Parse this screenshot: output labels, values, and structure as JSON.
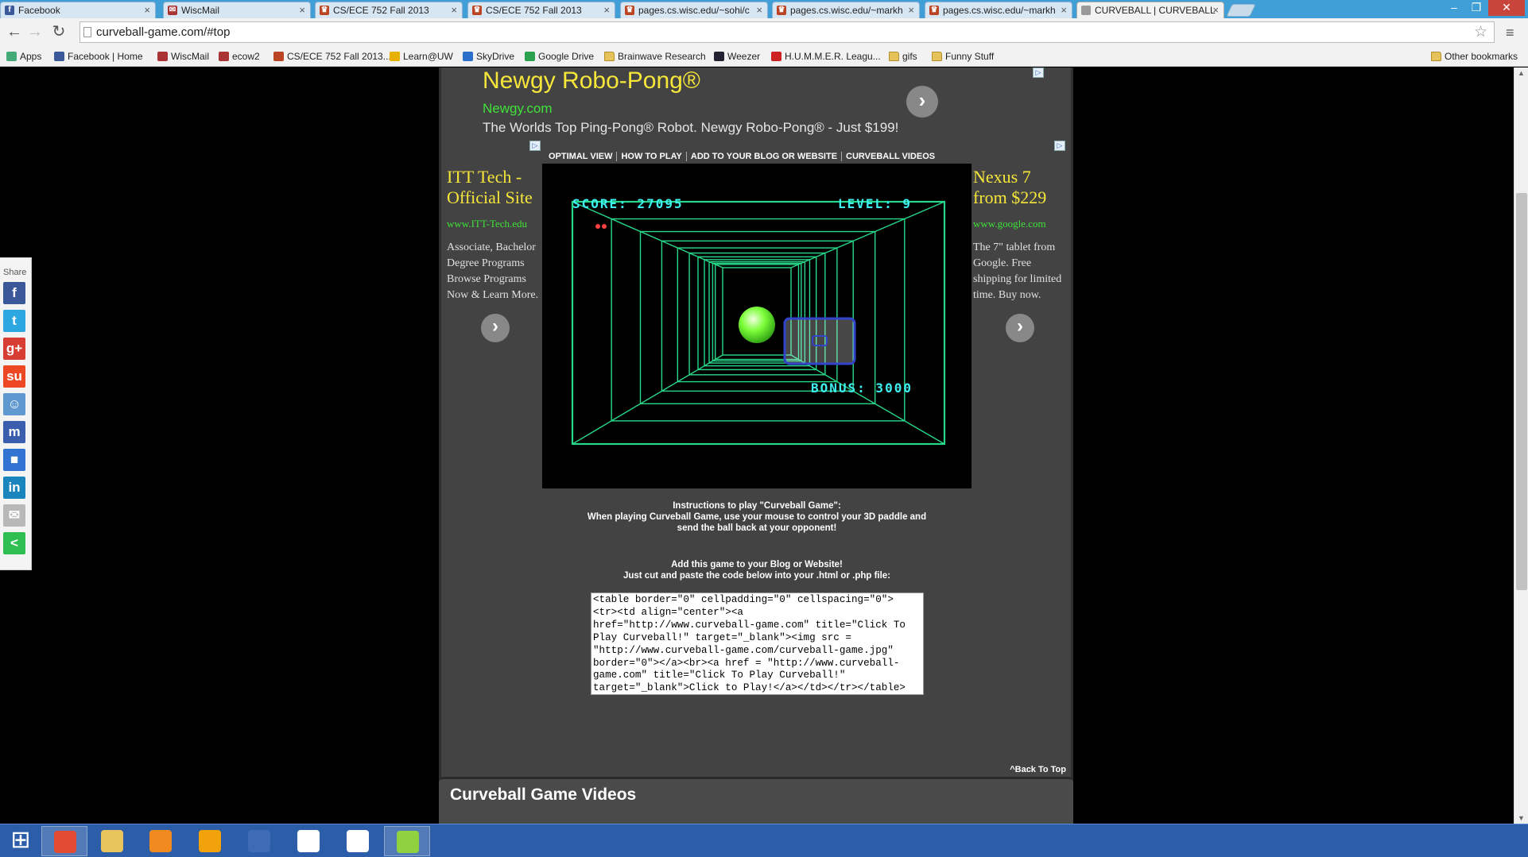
{
  "browser": {
    "tabs": [
      {
        "title": "Facebook",
        "icon": "facebook-icon",
        "color": "#3b5998",
        "glyph": "f"
      },
      {
        "title": "WiscMail",
        "icon": "mail-icon",
        "color": "#a33",
        "glyph": "✉"
      },
      {
        "title": "CS/ECE 752 Fall 2013",
        "icon": "uw-crest-icon",
        "color": "#b42",
        "glyph": "♛"
      },
      {
        "title": "CS/ECE 752 Fall 2013",
        "icon": "uw-crest-icon",
        "color": "#b42",
        "glyph": "♛"
      },
      {
        "title": "pages.cs.wisc.edu/~sohi/c",
        "icon": "uw-crest-icon",
        "color": "#b42",
        "glyph": "♛"
      },
      {
        "title": "pages.cs.wisc.edu/~markh",
        "icon": "uw-crest-icon",
        "color": "#b42",
        "glyph": "♛"
      },
      {
        "title": "pages.cs.wisc.edu/~markh",
        "icon": "uw-crest-icon",
        "color": "#b42",
        "glyph": "♛"
      },
      {
        "title": "CURVEBALL | CURVEBALL",
        "icon": "page-icon",
        "color": "#999",
        "glyph": ""
      }
    ],
    "tab_close_glyph": "×",
    "window_controls": {
      "minimize": "–",
      "maximize": "❐",
      "close": "✕"
    },
    "nav": {
      "back": "←",
      "forward": "→",
      "reload": "↻"
    },
    "url": "curveball-game.com/#top",
    "star_glyph": "☆",
    "menu_glyph": "≡",
    "bookmarks": [
      {
        "label": "Apps",
        "icon": "apps-icon",
        "color": "#4a7"
      },
      {
        "label": "Facebook | Home",
        "icon": "facebook-icon",
        "color": "#3b5998"
      },
      {
        "label": "WiscMail",
        "icon": "uw-crest-icon",
        "color": "#a33"
      },
      {
        "label": "ecow2",
        "icon": "uw-crest-icon",
        "color": "#a33"
      },
      {
        "label": "CS/ECE 752 Fall 2013...",
        "icon": "uw-crest-icon",
        "color": "#b42"
      },
      {
        "label": "Learn@UW",
        "icon": "star-icon",
        "color": "#e8b000"
      },
      {
        "label": "SkyDrive",
        "icon": "cloud-icon",
        "color": "#2a6fc9"
      },
      {
        "label": "Google Drive",
        "icon": "drive-icon",
        "color": "#2ba14d"
      },
      {
        "label": "Brainwave Research",
        "icon": "folder-icon",
        "color": "folder"
      },
      {
        "label": "Weezer",
        "icon": "weezer-icon",
        "color": "#223"
      },
      {
        "label": "H.U.M.M.E.R. Leagu...",
        "icon": "hummer-icon",
        "color": "#c22"
      },
      {
        "label": "gifs",
        "icon": "folder-icon",
        "color": "folder"
      },
      {
        "label": "Funny Stuff",
        "icon": "folder-icon",
        "color": "folder"
      }
    ],
    "other_bookmarks": "Other bookmarks"
  },
  "page": {
    "top_ad": {
      "title": "Newgy Robo-Pong®",
      "url": "Newgy.com",
      "description": "The Worlds Top Ping-Pong® Robot. Newgy Robo-Pong® - Just $199!"
    },
    "left_ad": {
      "title": "ITT Tech - Official Site",
      "url": "www.ITT-Tech.edu",
      "description": "Associate, Bachelor Degree Programs Browse Programs Now & Learn More."
    },
    "right_ad": {
      "title": "Nexus 7 from $229",
      "url": "www.google.com",
      "description": "The 7\" tablet from Google. Free shipping for limited time. Buy now."
    },
    "ad_next_glyph": "›",
    "ad_flag_glyph": "▷",
    "game_nav": [
      "OPTIMAL VIEW",
      "HOW TO PLAY",
      "ADD TO YOUR BLOG OR WEBSITE",
      "CURVEBALL VIDEOS"
    ],
    "game": {
      "score_label": "SCORE: 27095",
      "level_label": "LEVEL: 9",
      "bonus_label": "BONUS: 3000",
      "lives": 2,
      "colors": {
        "tunnel": "#27d88a",
        "hud": "#3ff0f0",
        "ball": "#7dff3a",
        "paddle": "#3344cc",
        "lives": "#ff4040"
      }
    },
    "instructions": {
      "heading": "Instructions to play \"Curveball Game\":",
      "body": "When playing Curveball Game, use your mouse to control your 3D paddle and send the ball back at your opponent!"
    },
    "add_game": {
      "heading": "Add this game to your Blog or Website!",
      "body": "Just cut and paste the code below into your .html or .php file:",
      "code": "<table border=\"0\" cellpadding=\"0\" cellspacing=\"0\">\n<tr><td align=\"center\"><a\nhref=\"http://www.curveball-game.com\" title=\"Click To\nPlay Curveball!\" target=\"_blank\"><img src =\n\"http://www.curveball-game.com/curveball-game.jpg\"\nborder=\"0\"></a><br><a href = \"http://www.curveball-\ngame.com\" title=\"Click To Play Curveball!\"\ntarget=\"_blank\">Click to Play!</a></td></tr></table>"
    },
    "back_to_top": "^Back To Top",
    "videos_heading": "Curveball Game Videos"
  },
  "share": {
    "label": "Share",
    "buttons": [
      {
        "name": "facebook-share",
        "glyph": "f",
        "color": "#3b5998"
      },
      {
        "name": "twitter-share",
        "glyph": "t",
        "color": "#2ca7e0"
      },
      {
        "name": "googleplus-share",
        "glyph": "g+",
        "color": "#d73d32"
      },
      {
        "name": "stumbleupon-share",
        "glyph": "su",
        "color": "#eb4823"
      },
      {
        "name": "reddit-share",
        "glyph": "☺",
        "color": "#5f99cf"
      },
      {
        "name": "myspace-share",
        "glyph": "m",
        "color": "#3a5dae"
      },
      {
        "name": "delicious-share",
        "glyph": "■",
        "color": "#3274d1"
      },
      {
        "name": "linkedin-share",
        "glyph": "in",
        "color": "#1a85bc"
      },
      {
        "name": "email-share",
        "glyph": "✉",
        "color": "#b8b8b8"
      },
      {
        "name": "more-share",
        "glyph": "<",
        "color": "#2fbe52"
      }
    ]
  },
  "taskbar": {
    "start_glyph": "⊞",
    "items": [
      {
        "name": "chrome-icon",
        "color": "#e34a33",
        "open": true
      },
      {
        "name": "explorer-icon",
        "color": "#e8c45c",
        "open": false
      },
      {
        "name": "media-player-icon",
        "color": "#f08a1e",
        "open": false
      },
      {
        "name": "outlook-icon",
        "color": "#f2a20a",
        "open": false
      },
      {
        "name": "lync-icon",
        "color": "#3d6bb5",
        "open": false
      },
      {
        "name": "mathworks-icon",
        "color": "#fff",
        "open": false
      },
      {
        "name": "vnc-icon",
        "color": "#fff",
        "open": false
      },
      {
        "name": "notepad-icon",
        "color": "#8fd13f",
        "open": true
      }
    ]
  }
}
